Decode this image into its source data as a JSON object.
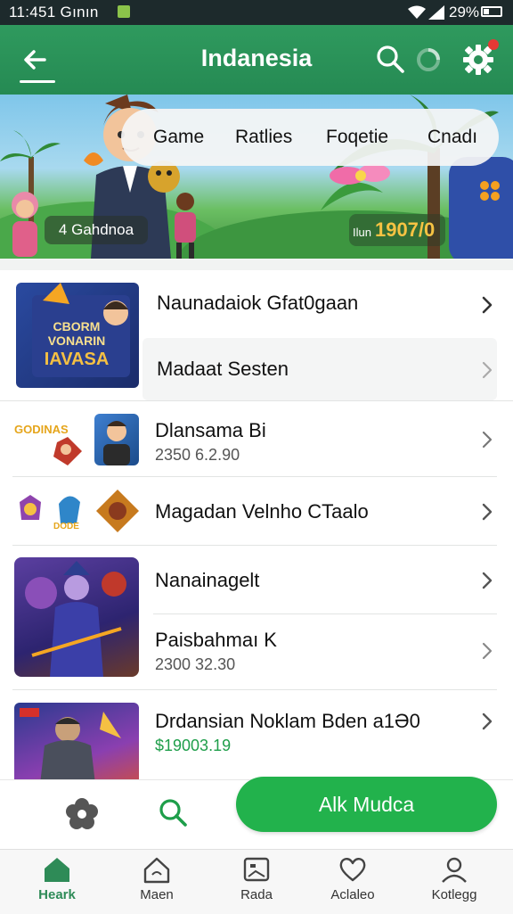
{
  "status_bar": {
    "time": "11:451 Gının",
    "battery": "29%"
  },
  "app_bar": {
    "title": "Indanesia"
  },
  "banner": {
    "tabs": [
      "Game",
      "Ratlies",
      "Foqetie",
      "Cnadı"
    ],
    "left_chip": "4 Gahdnoa",
    "right_chip_prefix": "Ilun",
    "right_chip_value": "1907/0"
  },
  "list": [
    {
      "name": "Naunadaiok Gfat0gaan",
      "sub": ""
    },
    {
      "name": "Madaat Sesten",
      "sub": ""
    },
    {
      "name": "Dlansama Bi",
      "sub": "2350 6.2.90"
    },
    {
      "name": "Magadan Velnho CTaalo",
      "sub": ""
    },
    {
      "name": "Nanainagelt",
      "sub": ""
    },
    {
      "name": "Paisbahmaı K",
      "sub": "2300 32.30"
    },
    {
      "name": "Drdansian Noklam Bden a1Ə0",
      "sub": "$19003.19"
    }
  ],
  "thumb_text": {
    "title_art": "CBORM VONARIN IAVASA",
    "small_logo": "GODINAS",
    "badge": "DODE"
  },
  "action_bar": {
    "cta_label": "Alk Mudca"
  },
  "bottom_nav": [
    {
      "label": "Heark",
      "active": true
    },
    {
      "label": "Maen"
    },
    {
      "label": "Rada"
    },
    {
      "label": "Aclaleo"
    },
    {
      "label": "Kotlegg"
    }
  ],
  "colors": {
    "primary": "#258a53",
    "cta": "#22b24c",
    "price": "#1e9e4a"
  }
}
